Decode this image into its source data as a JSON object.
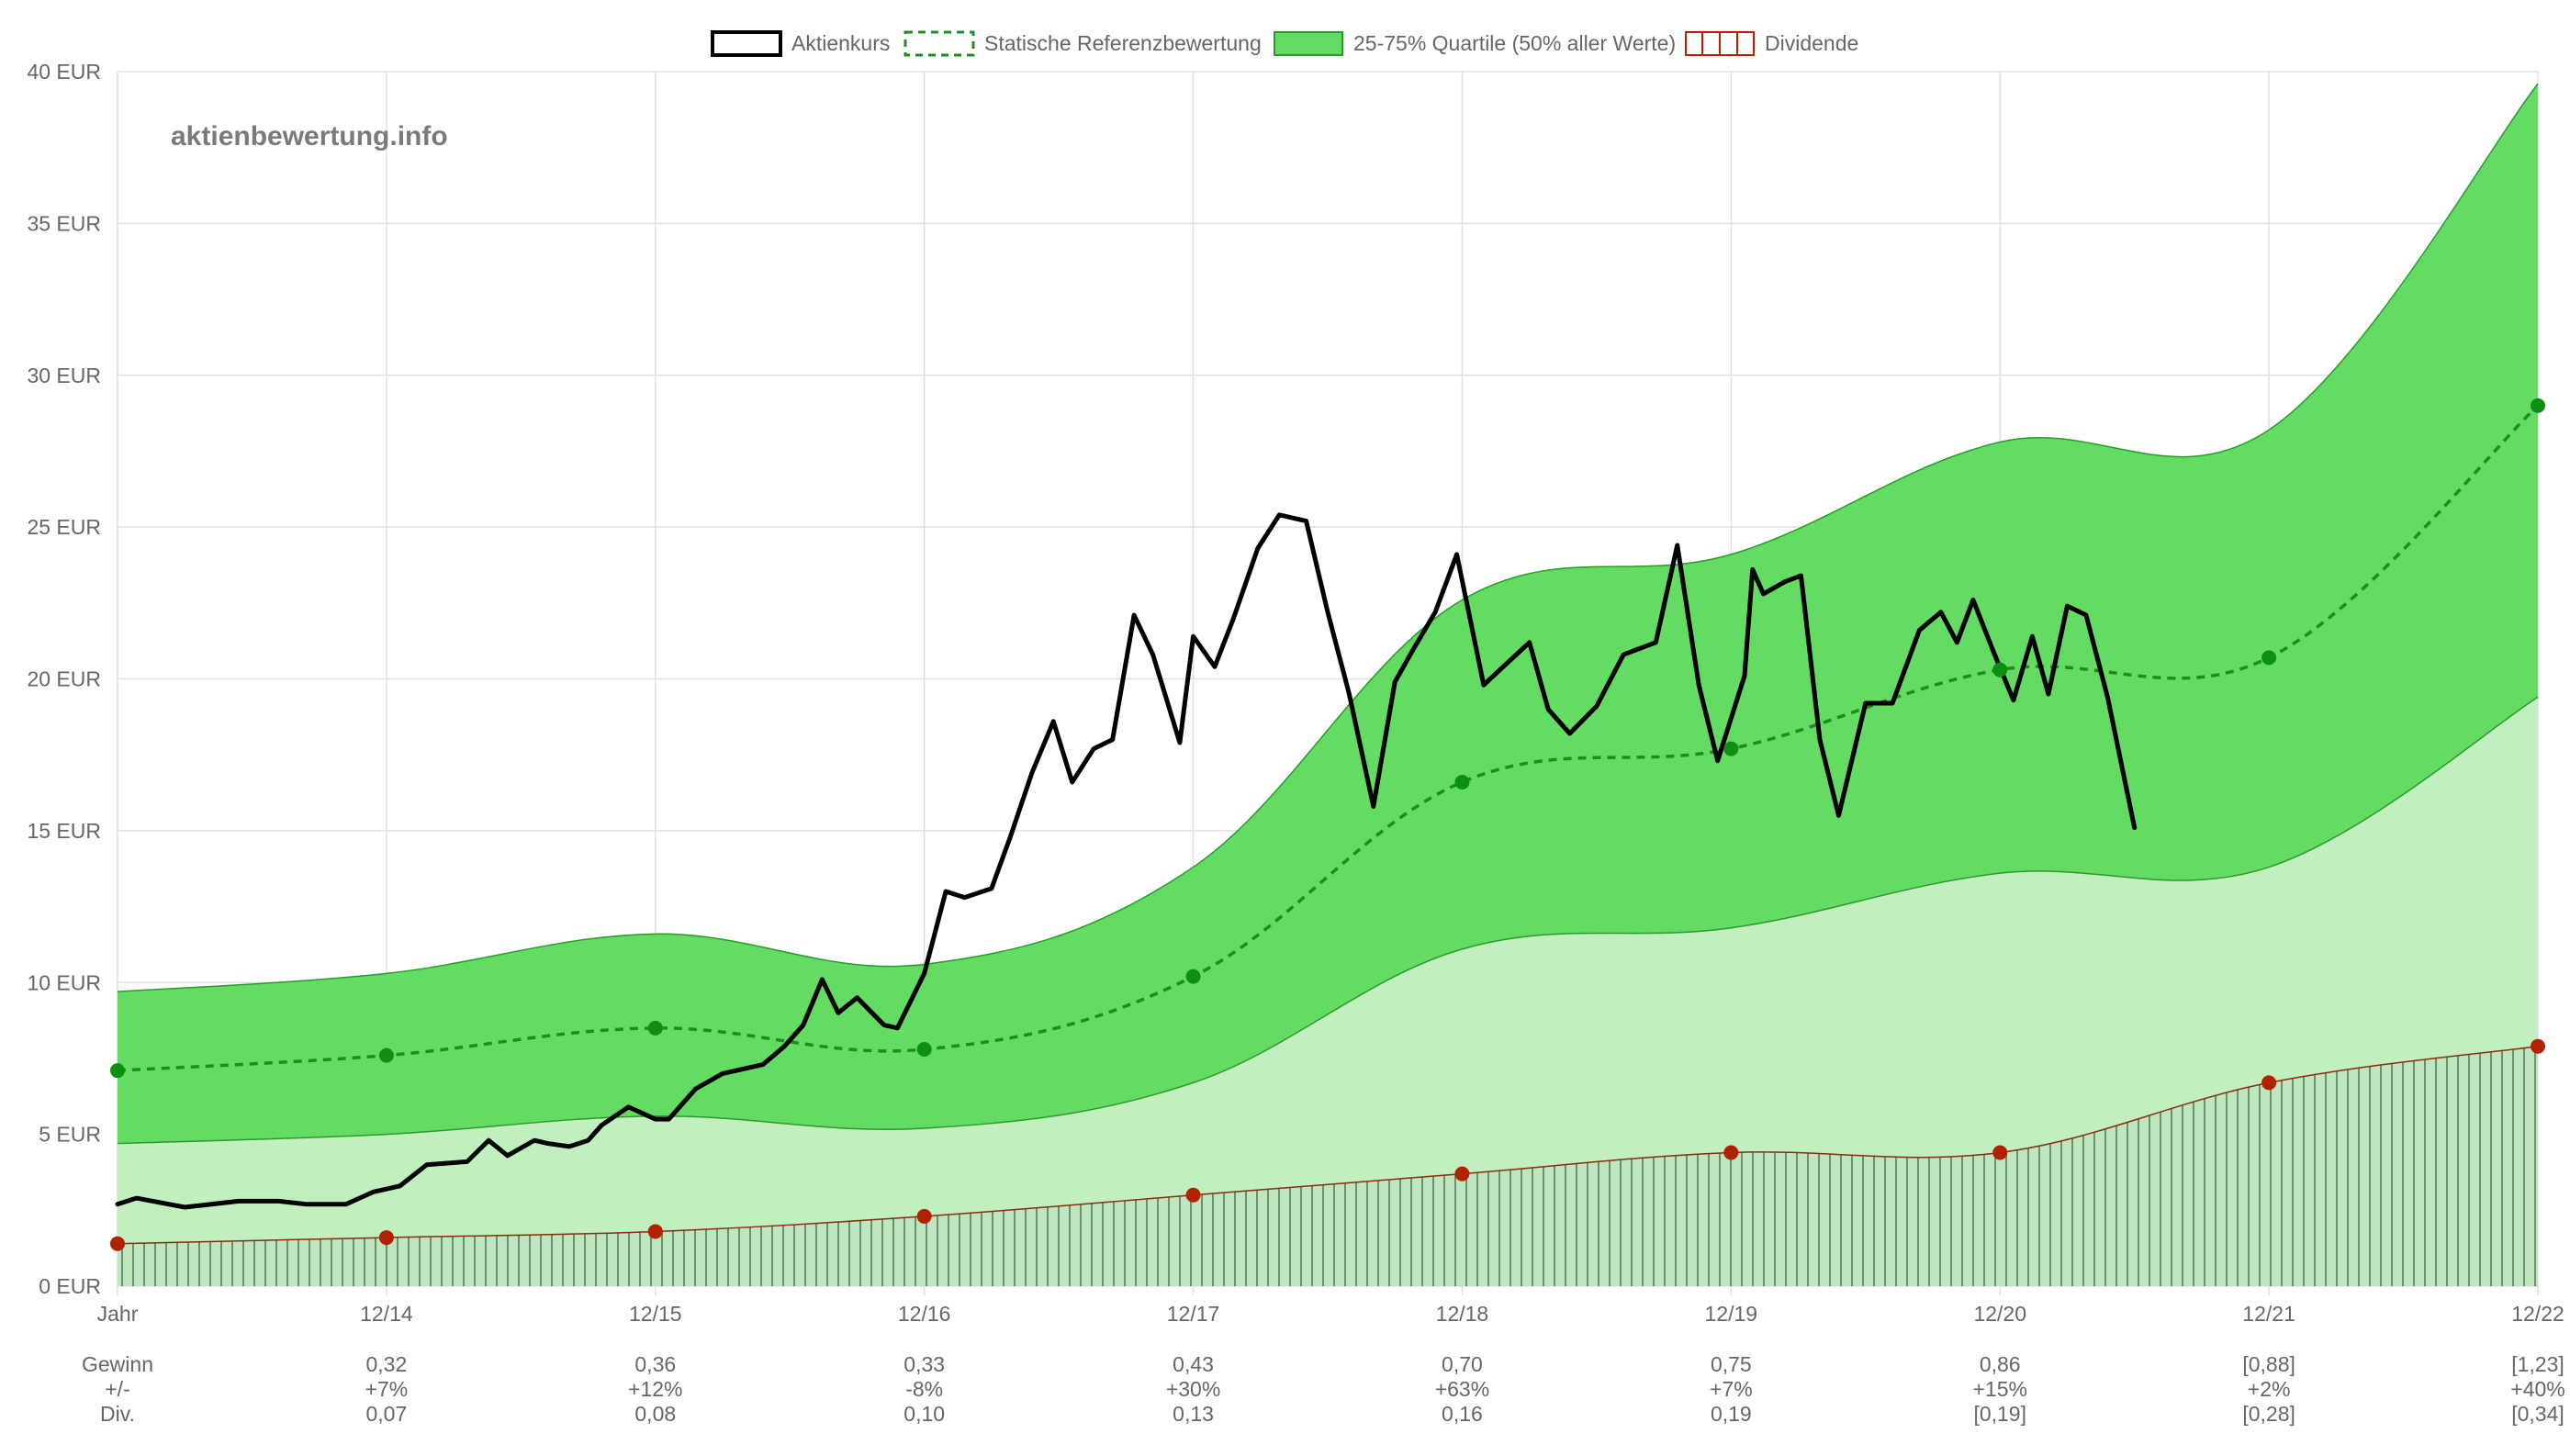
{
  "watermark": "aktienbewertung.info",
  "colors": {
    "price": "#000000",
    "reference": "#1e8c1e",
    "reference_point": "#0f8f0f",
    "quartile_fill": "#64dc64",
    "quartile_stroke": "#2a9a2a",
    "lower_fill": "#c1efc0",
    "dividend_fill": "#bfe6be",
    "dividend_hatch": "#6a8f6a",
    "dividend_line": "#8b2a10",
    "dividend_point": "#b22200",
    "grid": "#e0e0e0",
    "text": "#666666"
  },
  "chart_data": {
    "type": "line",
    "legend": {
      "placement": "top-center",
      "entries": [
        "Aktienkurs",
        "Statische Referenzbewertung",
        "25-75% Quartile (50% aller Werte)",
        "Dividende"
      ]
    },
    "x_categories": [
      "Jahr",
      "12/14",
      "12/15",
      "12/16",
      "12/17",
      "12/18",
      "12/19",
      "12/20",
      "12/21",
      "12/22"
    ],
    "y_axis": {
      "min": 0,
      "max": 40,
      "step": 5,
      "tick_labels": [
        "0 EUR",
        "5 EUR",
        "10 EUR",
        "15 EUR",
        "20 EUR",
        "25 EUR",
        "30 EUR",
        "35 EUR",
        "40 EUR"
      ]
    },
    "grid": true,
    "series": [
      {
        "name": "Statische Referenzbewertung",
        "style": "dashed-line-with-points",
        "values": [
          7.1,
          7.6,
          8.5,
          7.8,
          10.2,
          16.6,
          17.7,
          20.3,
          20.7,
          29.0
        ]
      },
      {
        "name": "25-75% Quartile (50% aller Werte)",
        "style": "band",
        "upper": [
          9.7,
          10.3,
          11.6,
          10.6,
          13.8,
          22.6,
          24.1,
          27.8,
          28.2,
          39.6
        ],
        "lower": [
          4.7,
          5.0,
          5.6,
          5.2,
          6.7,
          11.1,
          11.8,
          13.6,
          13.8,
          19.4
        ]
      },
      {
        "name": "Dividende",
        "style": "hatched-area-with-points",
        "values": [
          1.4,
          1.6,
          1.8,
          2.3,
          3.0,
          3.7,
          4.4,
          4.4,
          6.7,
          7.9
        ]
      },
      {
        "name": "Aktienkurs",
        "style": "line",
        "x_position": [
          0.0,
          0.07,
          0.25,
          0.45,
          0.6,
          0.7,
          0.85,
          0.95,
          1.0,
          1.05,
          1.15,
          1.3,
          1.38,
          1.45,
          1.55,
          1.6,
          1.68,
          1.75,
          1.8,
          1.9,
          2.0,
          2.05,
          2.15,
          2.25,
          2.3,
          2.4,
          2.48,
          2.55,
          2.62,
          2.68,
          2.75,
          2.85,
          2.9,
          3.0,
          3.08,
          3.15,
          3.25,
          3.32,
          3.4,
          3.48,
          3.55,
          3.63,
          3.7,
          3.78,
          3.85,
          3.95,
          4.0,
          4.08,
          4.15,
          4.24,
          4.32,
          4.42,
          4.5,
          4.58,
          4.67,
          4.75,
          4.82,
          4.9,
          4.98,
          5.08,
          5.25,
          5.32,
          5.4,
          5.5,
          5.6,
          5.72,
          5.8,
          5.88,
          5.95,
          6.05,
          6.08,
          6.12,
          6.2,
          6.26,
          6.33,
          6.4,
          6.5,
          6.6,
          6.7,
          6.78,
          6.84,
          6.9,
          6.98,
          7.05,
          7.12,
          7.18,
          7.25,
          7.32,
          7.4,
          7.5,
          7.58,
          7.66,
          7.74,
          7.82,
          7.88,
          7.94,
          7.98
        ],
        "values": [
          2.7,
          2.9,
          2.6,
          2.8,
          2.8,
          2.7,
          2.7,
          3.1,
          3.2,
          3.3,
          4.0,
          4.1,
          4.8,
          4.3,
          4.8,
          4.7,
          4.6,
          4.8,
          5.3,
          5.9,
          5.5,
          5.5,
          6.5,
          7.0,
          7.1,
          7.3,
          7.9,
          8.6,
          10.1,
          9.0,
          9.5,
          8.6,
          8.5,
          10.3,
          13.0,
          12.8,
          13.1,
          14.8,
          16.9,
          18.6,
          16.6,
          17.7,
          18.0,
          22.1,
          20.8,
          17.9,
          21.4,
          20.4,
          22.0,
          24.3,
          25.4,
          25.2,
          22.2,
          19.5,
          15.8,
          19.9,
          21.0,
          22.2,
          24.1,
          19.8,
          21.2,
          19.0,
          18.2,
          19.1,
          20.8,
          21.2,
          24.4,
          19.8,
          17.3,
          20.1,
          23.6,
          22.8,
          23.2,
          23.4,
          18.0,
          15.5,
          19.2,
          19.2,
          21.6,
          22.2,
          21.2,
          22.6,
          20.8,
          19.3,
          21.4,
          19.5,
          22.4,
          22.1,
          19.4,
          15.1
        ]
      }
    ],
    "table": {
      "rows": [
        {
          "label": "Gewinn",
          "values": [
            "0,32",
            "0,36",
            "0,33",
            "0,43",
            "0,70",
            "0,75",
            "0,86",
            "[0,88]",
            "[1,23]"
          ]
        },
        {
          "label": "+/-",
          "values": [
            "+7%",
            "+12%",
            "-8%",
            "+30%",
            "+63%",
            "+7%",
            "+15%",
            "+2%",
            "+40%"
          ]
        },
        {
          "label": "Div.",
          "values": [
            "0,07",
            "0,08",
            "0,10",
            "0,13",
            "0,16",
            "0,19",
            "[0,19]",
            "[0,28]",
            "[0,34]"
          ]
        }
      ]
    }
  }
}
